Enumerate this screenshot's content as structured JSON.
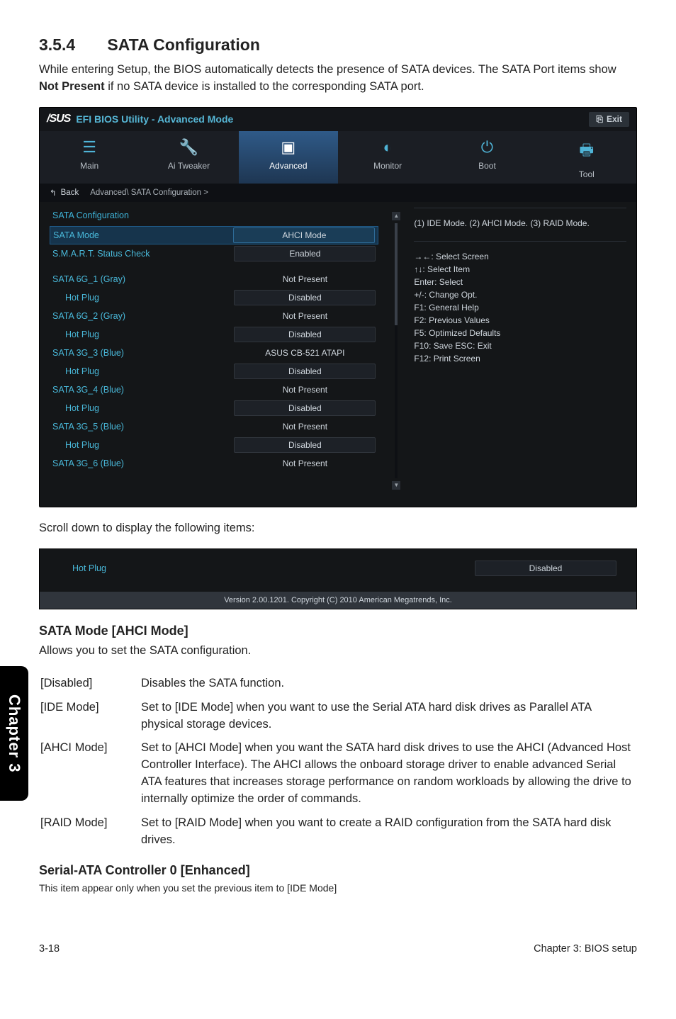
{
  "section": {
    "num": "3.5.4",
    "title": "SATA Configuration"
  },
  "intro": "While entering Setup, the BIOS automatically detects the presence of SATA devices. The SATA Port items show ",
  "intro_bold": "Not Present",
  "intro_tail": " if no SATA device is installed to the corresponding SATA port.",
  "bios": {
    "brand": "/SUS",
    "title": "EFI BIOS Utility - Advanced Mode",
    "exit": "Exit",
    "tabs": [
      "Main",
      "Ai  Tweaker",
      "Advanced",
      "Monitor",
      "Boot",
      "Tool"
    ],
    "back": "Back",
    "breadcrumb": "Advanced\\  SATA Configuration  >",
    "heading": "SATA Configuration",
    "rows": [
      {
        "label": "SATA Mode",
        "val": "AHCI Mode",
        "type": "box",
        "sel": true
      },
      {
        "label": "S.M.A.R.T. Status Check",
        "val": "Enabled",
        "type": "box"
      },
      {
        "spacer": true
      },
      {
        "label": "SATA 6G_1 (Gray)",
        "val": "Not Present",
        "type": "plain"
      },
      {
        "label": "Hot Plug",
        "val": "Disabled",
        "type": "box",
        "indent": true
      },
      {
        "label": "SATA 6G_2 (Gray)",
        "val": "Not Present",
        "type": "plain"
      },
      {
        "label": "Hot Plug",
        "val": "Disabled",
        "type": "box",
        "indent": true
      },
      {
        "label": "SATA 3G_3 (Blue)",
        "val": "ASUS   CB-521 ATAPI",
        "type": "plain"
      },
      {
        "label": "Hot Plug",
        "val": "Disabled",
        "type": "box",
        "indent": true
      },
      {
        "label": "SATA 3G_4 (Blue)",
        "val": "Not Present",
        "type": "plain"
      },
      {
        "label": "Hot Plug",
        "val": "Disabled",
        "type": "box",
        "indent": true
      },
      {
        "label": "SATA 3G_5 (Blue)",
        "val": "Not Present",
        "type": "plain"
      },
      {
        "label": "Hot Plug",
        "val": "Disabled",
        "type": "box",
        "indent": true
      },
      {
        "label": "SATA 3G_6 (Blue)",
        "val": "Not Present",
        "type": "plain"
      }
    ],
    "help_top": "(1) IDE Mode. (2) AHCI Mode. (3) RAID Mode.",
    "help_keys": "→←:  Select Screen\n↑↓:  Select Item\nEnter:  Select\n+/-:  Change Opt.\nF1:  General Help\nF2:  Previous Values\nF5:  Optimized Defaults\nF10:  Save   ESC:  Exit\nF12: Print Screen"
  },
  "scroll_note": "Scroll down to display the following items:",
  "snippet": {
    "row_label": "Hot Plug",
    "row_val": "Disabled",
    "version": "Version  2.00.1201.   Copyright  (C)  2010  American  Megatrends,  Inc."
  },
  "sata_mode": {
    "title": "SATA Mode [AHCI Mode]",
    "desc": "Allows you to set the SATA configuration.",
    "opts": [
      {
        "k": "[Disabled]",
        "v": "Disables the SATA function."
      },
      {
        "k": "[IDE Mode]",
        "v": "Set to [IDE Mode] when you want to use the Serial ATA hard disk drives as Parallel ATA physical storage devices."
      },
      {
        "k": "[AHCI Mode]",
        "v": "Set to [AHCI Mode] when you want the SATA hard disk drives to use the AHCI (Advanced Host Controller Interface). The AHCI allows the onboard storage driver to enable advanced Serial ATA features that increases storage performance on random workloads by allowing the drive to internally optimize the order of commands."
      },
      {
        "k": "[RAID Mode]",
        "v": "Set to [RAID Mode] when you want to create a RAID configuration from the SATA hard disk drives."
      }
    ]
  },
  "serial_ata": {
    "title": "Serial-ATA Controller 0 [Enhanced]",
    "desc": "This item appear only when you set the previous item to [IDE Mode]"
  },
  "chapter_tab": "Chapter 3",
  "footer": {
    "left": "3-18",
    "right": "Chapter 3: BIOS setup"
  }
}
